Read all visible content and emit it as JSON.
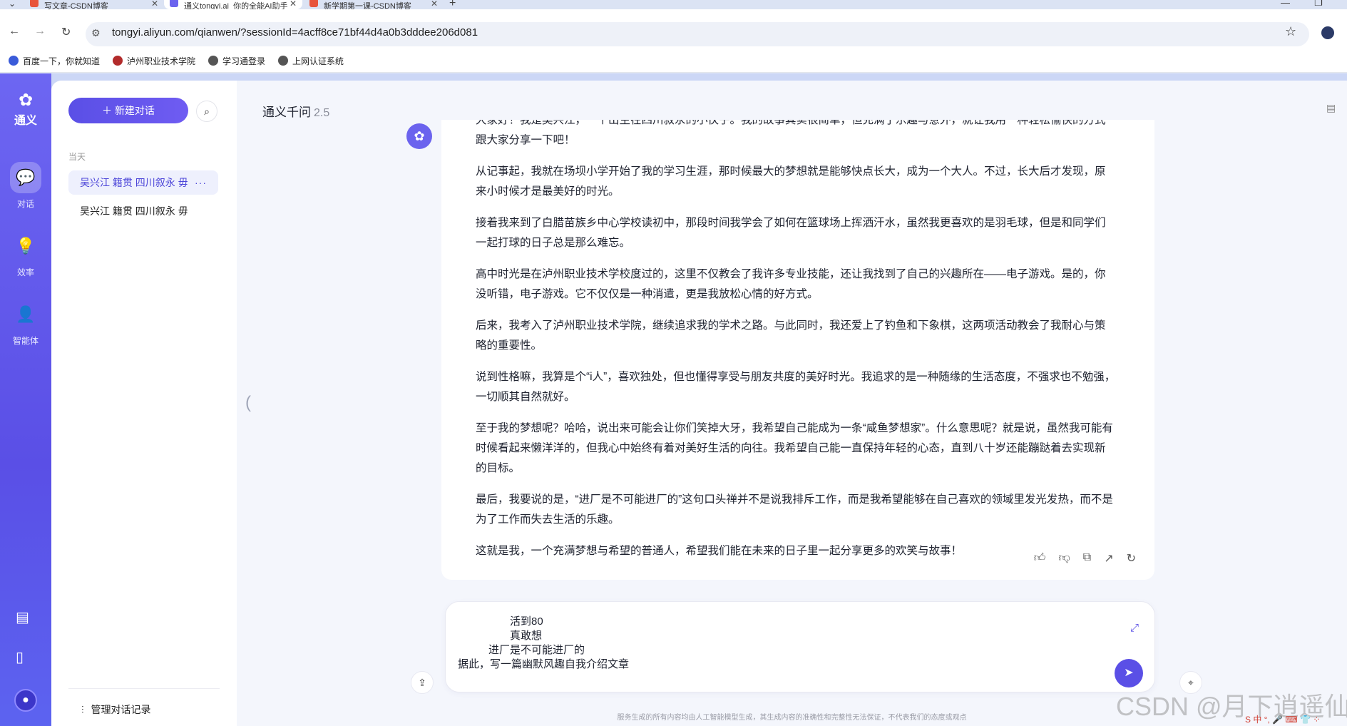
{
  "browser": {
    "tabs": [
      {
        "label": "写文章-CSDN博客",
        "favicon_color": "#e8543c"
      },
      {
        "label": "通义tongyi.ai_你的全能AI助手",
        "favicon_color": "#6b63ee"
      },
      {
        "label": "新学期第一课-CSDN博客",
        "favicon_color": "#e8543c"
      }
    ],
    "url": "tongyi.aliyun.com/qianwen/?sessionId=4acff8ce71bf44d4a0b3dddee206d081",
    "bookmarks": [
      {
        "label": "百度一下，你就知道",
        "icon_color": "#3a5bd9"
      },
      {
        "label": "泸州职业技术学院",
        "icon_color": "#b22b2b"
      },
      {
        "label": "学习通登录",
        "icon_color": "#555555"
      },
      {
        "label": "上网认证系统",
        "icon_color": "#555555"
      }
    ]
  },
  "rail": {
    "logo_text": "通义",
    "items": [
      {
        "label": "对话",
        "icon": "chat-icon"
      },
      {
        "label": "效率",
        "icon": "bulb-icon"
      },
      {
        "label": "智能体",
        "icon": "agent-icon"
      }
    ]
  },
  "sidebar": {
    "new_chat_label": "新建对话",
    "section_label": "当天",
    "conversations": [
      {
        "title": "吴兴江 籍贯 四川叙永 毋"
      },
      {
        "title": "吴兴江 籍贯 四川叙永 毋"
      }
    ],
    "more_label": "···",
    "manage_label": "管理对话记录"
  },
  "main": {
    "model_name": "通义千问",
    "model_version": "2.5",
    "answer_paragraphs": [
      "大家好！我是吴兴江，一个出生在四川叙永的小伙子。我的故事其实很简单，但充满了乐趣与意外，就让我用一种轻松愉快的方式跟大家分享一下吧！",
      "从记事起，我就在场坝小学开始了我的学习生涯，那时候最大的梦想就是能够快点长大，成为一个大人。不过，长大后才发现，原来小时候才是最美好的时光。",
      "接着我来到了白腊苗族乡中心学校读初中，那段时间我学会了如何在篮球场上挥洒汗水，虽然我更喜欢的是羽毛球，但是和同学们一起打球的日子总是那么难忘。",
      "高中时光是在泸州职业技术学校度过的，这里不仅教会了我许多专业技能，还让我找到了自己的兴趣所在——电子游戏。是的，你没听错，电子游戏。它不仅仅是一种消遣，更是我放松心情的好方式。",
      "后来，我考入了泸州职业技术学院，继续追求我的学术之路。与此同时，我还爱上了钓鱼和下象棋，这两项活动教会了我耐心与策略的重要性。",
      "说到性格嘛，我算是个“i人”，喜欢独处，但也懂得享受与朋友共度的美好时光。我追求的是一种随缘的生活态度，不强求也不勉强，一切顺其自然就好。",
      "至于我的梦想呢？哈哈，说出来可能会让你们笑掉大牙，我希望自己能成为一条“咸鱼梦想家”。什么意思呢？就是说，虽然我可能有时候看起来懒洋洋的，但我心中始终有着对美好生活的向往。我希望自己能一直保持年轻的心态，直到八十岁还能蹦跶着去实现新的目标。",
      "最后，我要说的是，“进厂是不可能进厂的”这句口头禅并不是说我排斥工作，而是我希望能够在自己喜欢的领域里发光发热，而不是为了工作而失去生活的乐趣。",
      "这就是我，一个充满梦想与希望的普通人，希望我们能在未来的日子里一起分享更多的欢笑与故事！"
    ],
    "input_lines": [
      "活到80",
      "真敢想",
      "进厂是不可能进厂的",
      "据此，写一篇幽默风趣自我介绍文章"
    ],
    "disclaimer": "服务生成的所有内容均由人工智能模型生成，其生成内容的准确性和完整性无法保证，不代表我们的态度或观点"
  },
  "overlay": {
    "watermark": "CSDN @月下逍遥仙",
    "ime_text": "S 中 °, 🎤 ⌨ 👕 ⁘"
  },
  "colors": {
    "accent": "#5a4fe6",
    "rail": "#6d66f2",
    "page_bg": "#f4f6fc"
  }
}
